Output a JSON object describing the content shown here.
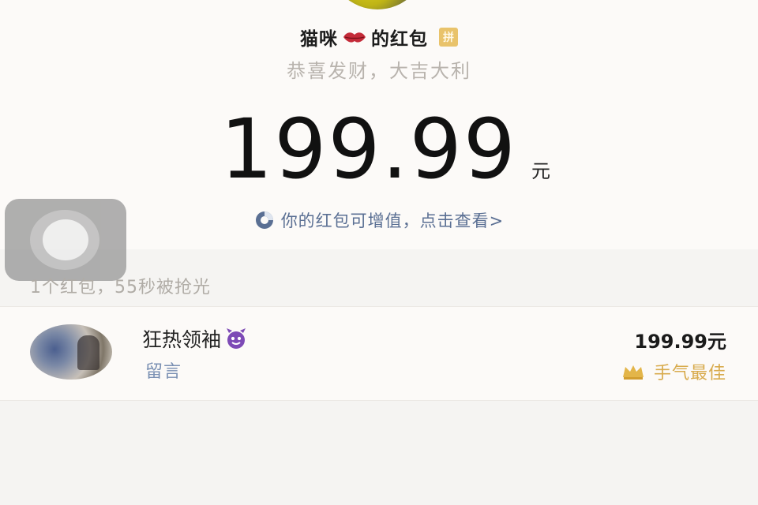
{
  "sender": {
    "name": "猫咪",
    "name_suffix": "的红包",
    "badge": "拼",
    "greeting": "恭喜发财，大吉大利"
  },
  "amount": {
    "value": "199.99",
    "unit": "元"
  },
  "value_link": {
    "text": "你的红包可增值，点击查看>"
  },
  "summary": {
    "text": "1个红包，55秒被抢光"
  },
  "records": [
    {
      "name": "狂热领袖",
      "message": "留言",
      "amount": "199.99元",
      "tag": "手气最佳"
    }
  ],
  "icons": {
    "lips": "lips-icon",
    "devil": "devil-icon",
    "crown": "crown-icon",
    "value_link": "value-link-icon"
  },
  "colors": {
    "gold": "#d8ab4d",
    "link_blue": "#5a6f93",
    "lips_red": "#c42b39",
    "devil_purple": "#7d4ab6"
  }
}
